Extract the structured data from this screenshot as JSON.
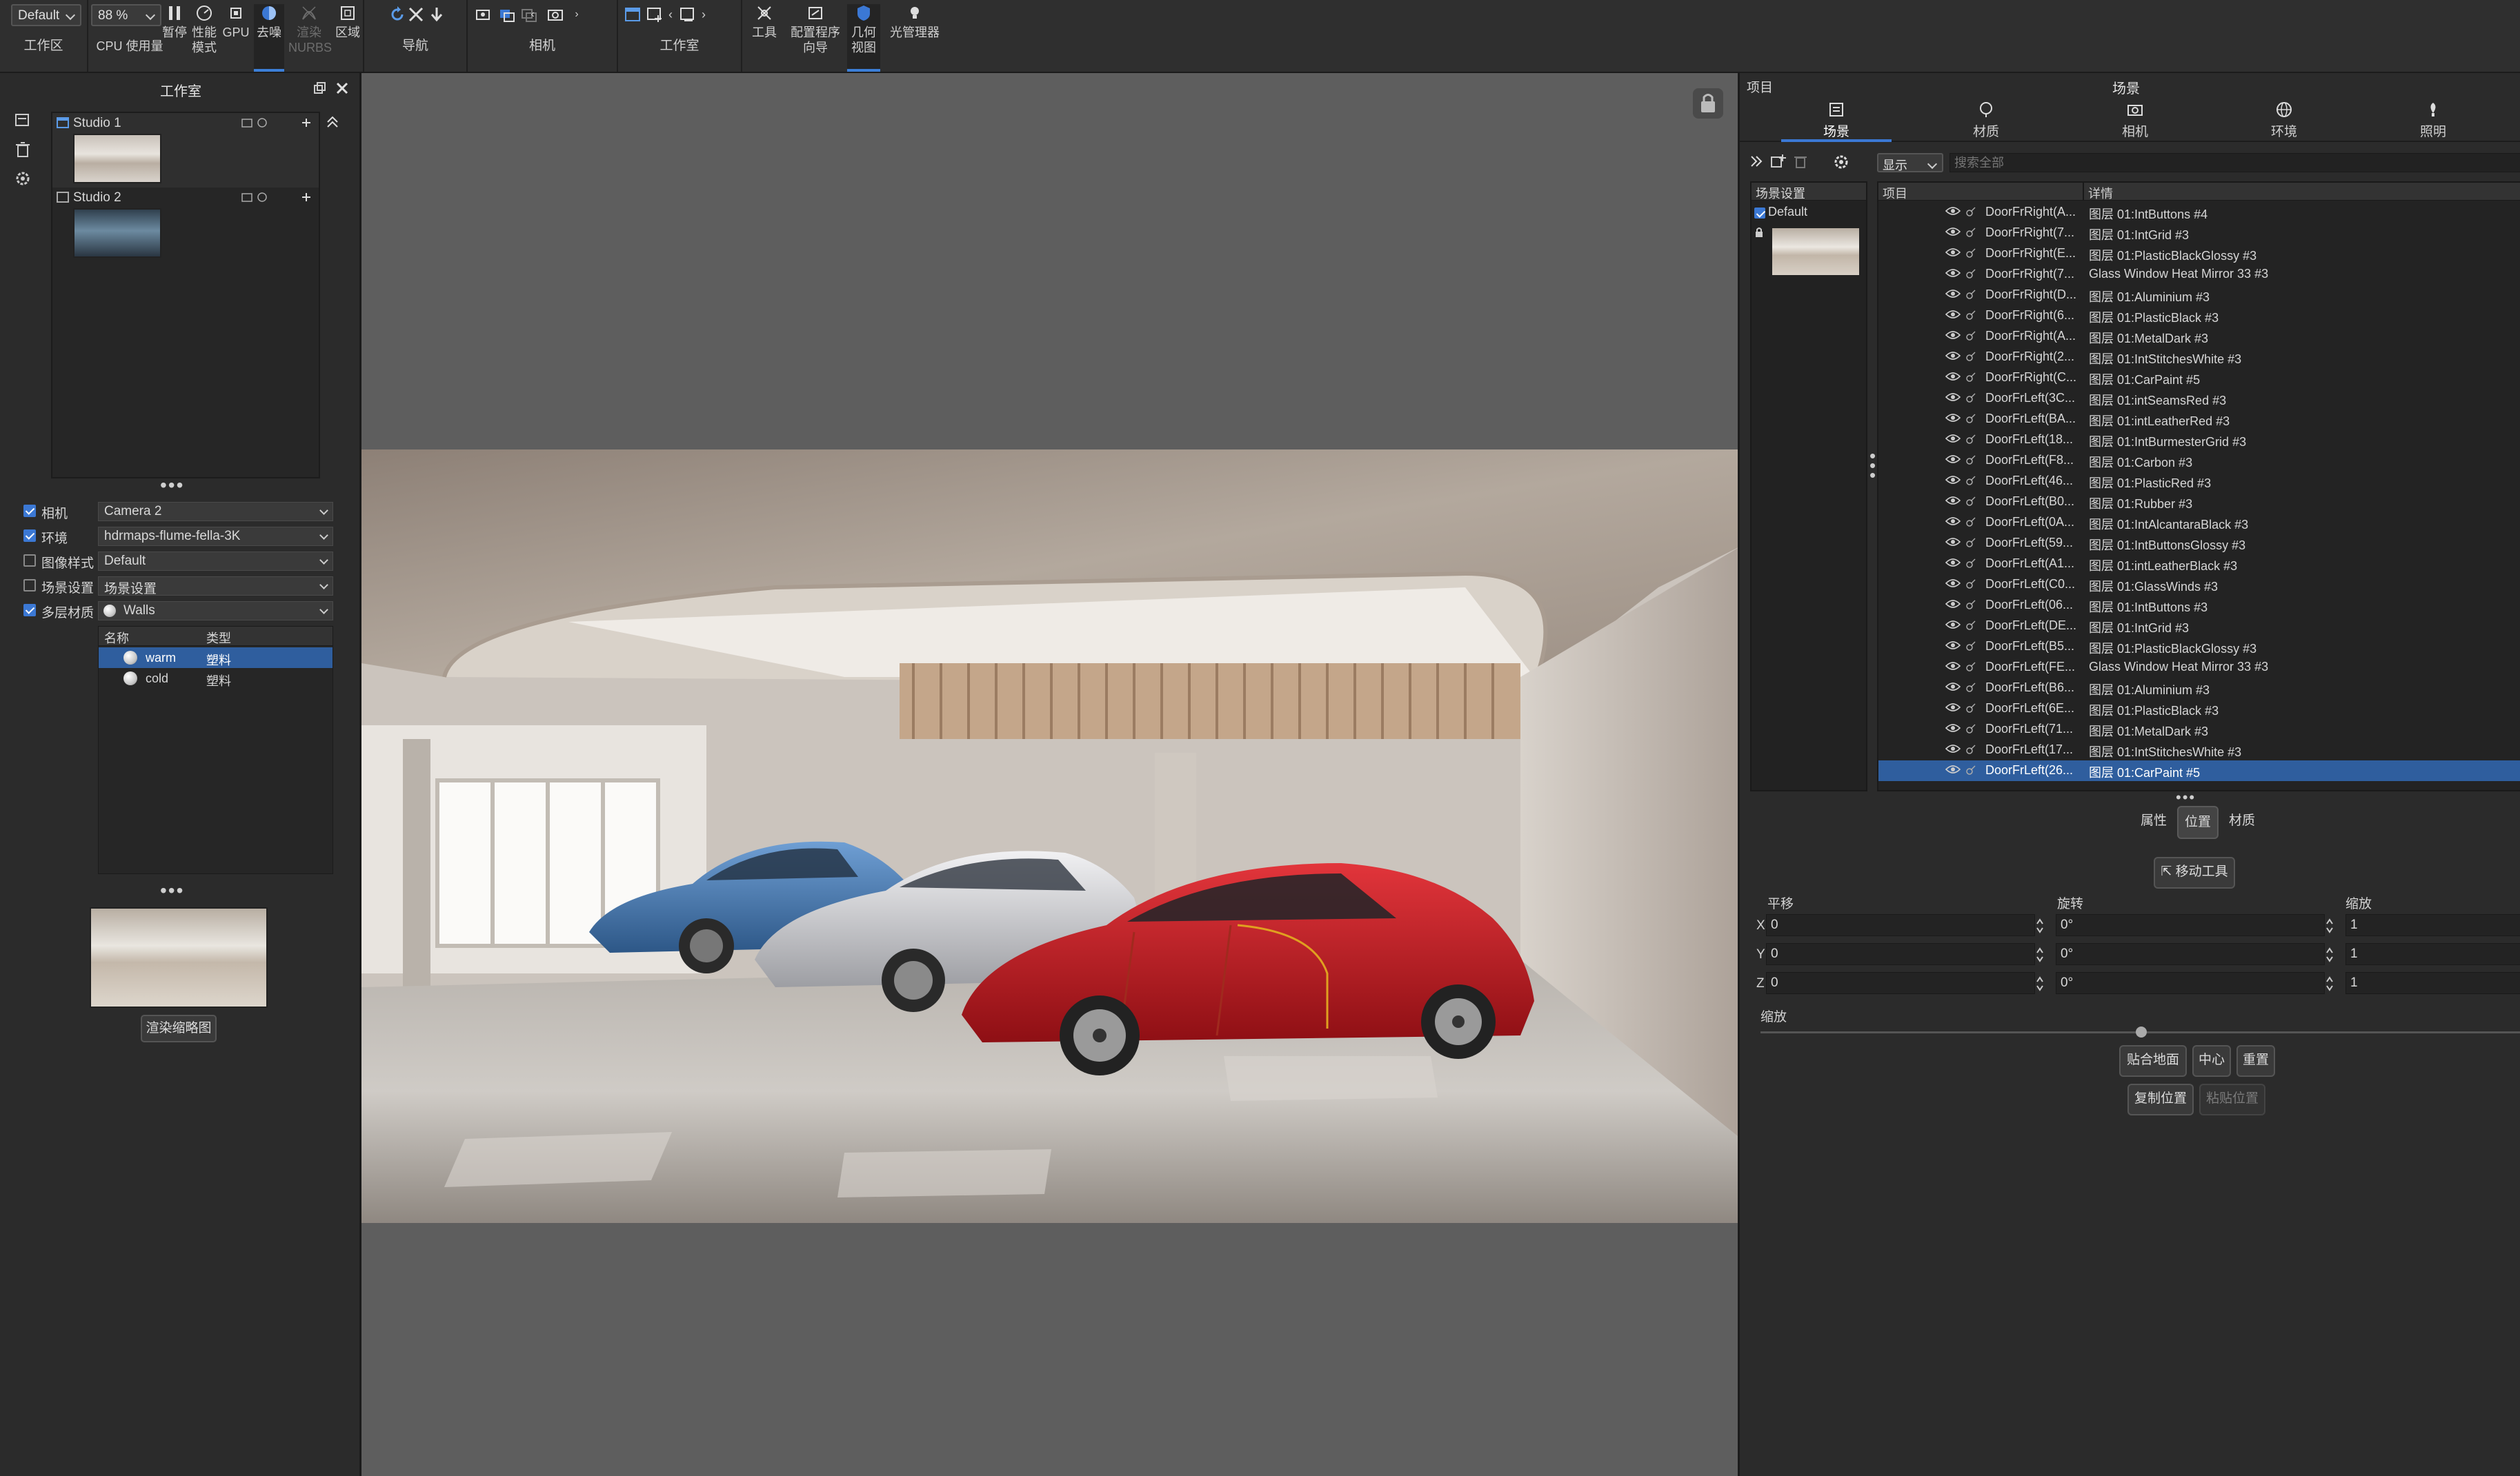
{
  "toolbar": {
    "workspace_select": "Default",
    "zoom_select": "88 %",
    "workspace_label": "工作区",
    "cpu_label": "CPU 使用量",
    "pause_label": "暂停",
    "perf_label_1": "性能",
    "perf_label_2": "模式",
    "gpu_label": "GPU",
    "denoise_label": "去噪",
    "nurbs_label_1": "渲染",
    "nurbs_label_2": "NURBS",
    "region_label": "区域",
    "nav_label": "导航",
    "camera_label": "相机",
    "studio_label": "工作室",
    "tools_label": "工具",
    "config_label_1": "配置程序",
    "config_label_2": "向导",
    "geo_label_1": "几何",
    "geo_label_2": "视图",
    "light_mgr_label": "光管理器"
  },
  "left": {
    "title": "工作室",
    "studios": [
      {
        "name": "Studio 1"
      },
      {
        "name": "Studio 2"
      }
    ],
    "options": [
      {
        "label": "相机",
        "checked": true,
        "value": "Camera 2"
      },
      {
        "label": "环境",
        "checked": true,
        "value": "hdrmaps-flume-fella-3K"
      },
      {
        "label": "图像样式",
        "checked": false,
        "value": "Default"
      },
      {
        "label": "场景设置",
        "checked": false,
        "value": "场景设置"
      },
      {
        "label": "多层材质",
        "checked": true,
        "value": "Walls"
      }
    ],
    "mat_head": {
      "name": "名称",
      "type": "类型"
    },
    "materials": [
      {
        "name": "warm",
        "type": "塑料"
      },
      {
        "name": "cold",
        "type": "塑料"
      }
    ],
    "render_thumb_button": "渲染缩略图"
  },
  "right": {
    "project_label": "项目",
    "scene_title": "场景",
    "tabs": [
      {
        "label": "场景",
        "icon": "scene-icon"
      },
      {
        "label": "材质",
        "icon": "material-icon"
      },
      {
        "label": "相机",
        "icon": "camera-icon"
      },
      {
        "label": "环境",
        "icon": "globe-icon"
      },
      {
        "label": "照明",
        "icon": "light-icon"
      }
    ],
    "display_select": "显示",
    "search_placeholder": "搜索全部",
    "tree_head": "场景设置",
    "tree_default": "Default",
    "grid_head": {
      "item": "项目",
      "detail": "详情"
    },
    "rows": [
      {
        "item": "DoorFrRight(A...",
        "detail": "图层 01:IntButtons #4"
      },
      {
        "item": "DoorFrRight(7...",
        "detail": "图层 01:IntGrid #3"
      },
      {
        "item": "DoorFrRight(E...",
        "detail": "图层 01:PlasticBlackGlossy #3"
      },
      {
        "item": "DoorFrRight(7...",
        "detail": "Glass Window Heat Mirror 33 #3"
      },
      {
        "item": "DoorFrRight(D...",
        "detail": "图层 01:Aluminium #3"
      },
      {
        "item": "DoorFrRight(6...",
        "detail": "图层 01:PlasticBlack #3"
      },
      {
        "item": "DoorFrRight(A...",
        "detail": "图层 01:MetalDark #3"
      },
      {
        "item": "DoorFrRight(2...",
        "detail": "图层 01:IntStitchesWhite #3"
      },
      {
        "item": "DoorFrRight(C...",
        "detail": "图层 01:CarPaint #5"
      },
      {
        "item": "DoorFrLeft(3C...",
        "detail": "图层 01:intSeamsRed #3"
      },
      {
        "item": "DoorFrLeft(BA...",
        "detail": "图层 01:intLeatherRed #3"
      },
      {
        "item": "DoorFrLeft(18...",
        "detail": "图层 01:IntBurmesterGrid #3"
      },
      {
        "item": "DoorFrLeft(F8...",
        "detail": "图层 01:Carbon #3"
      },
      {
        "item": "DoorFrLeft(46...",
        "detail": "图层 01:PlasticRed #3"
      },
      {
        "item": "DoorFrLeft(B0...",
        "detail": "图层 01:Rubber #3"
      },
      {
        "item": "DoorFrLeft(0A...",
        "detail": "图层 01:IntAlcantaraBlack #3"
      },
      {
        "item": "DoorFrLeft(59...",
        "detail": "图层 01:IntButtonsGlossy #3"
      },
      {
        "item": "DoorFrLeft(A1...",
        "detail": "图层 01:intLeatherBlack #3"
      },
      {
        "item": "DoorFrLeft(C0...",
        "detail": "图层 01:GlassWinds #3"
      },
      {
        "item": "DoorFrLeft(06...",
        "detail": "图层 01:IntButtons #3"
      },
      {
        "item": "DoorFrLeft(DE...",
        "detail": "图层 01:IntGrid #3"
      },
      {
        "item": "DoorFrLeft(B5...",
        "detail": "图层 01:PlasticBlackGlossy #3"
      },
      {
        "item": "DoorFrLeft(FE...",
        "detail": "Glass Window Heat Mirror 33 #3"
      },
      {
        "item": "DoorFrLeft(B6...",
        "detail": "图层 01:Aluminium #3"
      },
      {
        "item": "DoorFrLeft(6E...",
        "detail": "图层 01:PlasticBlack #3"
      },
      {
        "item": "DoorFrLeft(71...",
        "detail": "图层 01:MetalDark #3"
      },
      {
        "item": "DoorFrLeft(17...",
        "detail": "图层 01:IntStitchesWhite #3"
      },
      {
        "item": "DoorFrLeft(26...",
        "detail": "图层 01:CarPaint #5"
      }
    ],
    "selected_row": 27,
    "segments": [
      "属性",
      "位置",
      "材质"
    ],
    "move_tool": "移动工具",
    "translate_label": "平移",
    "rotate_label": "旋转",
    "scale_label": "缩放",
    "axes": [
      {
        "axis": "X",
        "translate": "0",
        "rotate": "0°",
        "scale": "1"
      },
      {
        "axis": "Y",
        "translate": "0",
        "rotate": "0°",
        "scale": "1"
      },
      {
        "axis": "Z",
        "translate": "0",
        "rotate": "0°",
        "scale": "1"
      }
    ],
    "scale_slider_label": "缩放",
    "scale_slider_value": 0.5,
    "buttons_row1": [
      "贴合地面",
      "中心",
      "重置"
    ],
    "buttons_row2": [
      "复制位置",
      "粘贴位置"
    ]
  },
  "colors": {
    "accent": "#3b78d4",
    "selection": "#2f5e9e",
    "car_red": "#c0161b",
    "car_blue": "#4a7fb8",
    "car_silver": "#d8d8dc"
  }
}
